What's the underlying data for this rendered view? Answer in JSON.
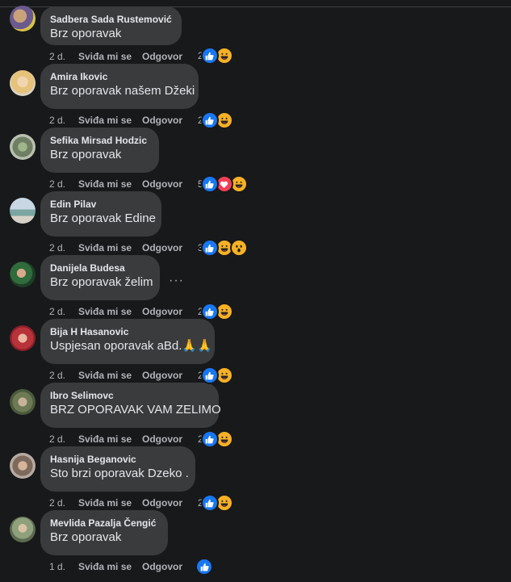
{
  "actions": {
    "like_label": "Sviđa mi se",
    "reply_label": "Odgovor"
  },
  "comments": [
    {
      "name": "Sadbera Sada Rustemović",
      "text": "Brz oporavak",
      "time": "2 d.",
      "count": "2",
      "reactions": [
        "like",
        "haha"
      ]
    },
    {
      "name": "Amira Ikovic",
      "text": "Brz oporavak našem Džeki",
      "time": "2 d.",
      "count": "2",
      "reactions": [
        "like",
        "haha"
      ]
    },
    {
      "name": "Sefika Mirsad Hodzic",
      "text": "Brz oporavak",
      "time": "2 d.",
      "count": "5",
      "reactions": [
        "like",
        "love",
        "haha"
      ]
    },
    {
      "name": "Edin Pilav",
      "text": "Brz oporavak Edine",
      "time": "2 d.",
      "count": "3",
      "reactions": [
        "like",
        "haha",
        "wow"
      ]
    },
    {
      "name": "Danijela Budesa",
      "text": "Brz oporavak želim",
      "time": "2 d.",
      "count": "2",
      "reactions": [
        "like",
        "haha"
      ]
    },
    {
      "name": "Bija H Hasanovic",
      "text": "Uspjesan oporavak aBd.🙏🙏",
      "time": "2 d.",
      "count": "2",
      "reactions": [
        "like",
        "haha"
      ]
    },
    {
      "name": "Ibro Selimovc",
      "text": "BRZ OPORAVAK VAM ZELIMO",
      "time": "2 d.",
      "count": "2",
      "reactions": [
        "like",
        "haha"
      ]
    },
    {
      "name": "Hasnija Beganovic",
      "text": "Sto brzi oporavak Dzeko .",
      "time": "2 d.",
      "count": "2",
      "reactions": [
        "like",
        "haha"
      ]
    },
    {
      "name": "Mevlida Pazalja Čengić",
      "text": "Brz oporavak",
      "time": "1 d.",
      "count": "",
      "reactions": [
        "like"
      ]
    }
  ],
  "more_options": "···",
  "colors": {
    "background": "#18191a",
    "bubble": "#3a3b3c",
    "like": "#1877f2",
    "love": "#f33e58",
    "haha": "#f7b125"
  }
}
